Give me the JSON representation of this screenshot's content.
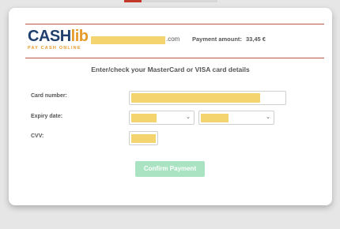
{
  "header": {
    "logo_main": "CASH",
    "logo_accent": "lib",
    "logo_tagline": "PAY CASH ONLINE",
    "merchant_suffix": ".com",
    "amount_label": "Payment amount:",
    "amount_value": "33,45 €"
  },
  "form": {
    "heading": "Enter/check your MasterCard or VISA card details",
    "card_number_label": "Card number:",
    "expiry_label": "Expiry date:",
    "cvv_label": "CVV:",
    "confirm_label": "Confirm Payment"
  },
  "colors": {
    "brand_blue": "#1f3f6e",
    "brand_orange": "#e59a2a",
    "rule": "#b85a4f",
    "redaction": "#f4d46f",
    "button_disabled": "#a9e3c2"
  }
}
